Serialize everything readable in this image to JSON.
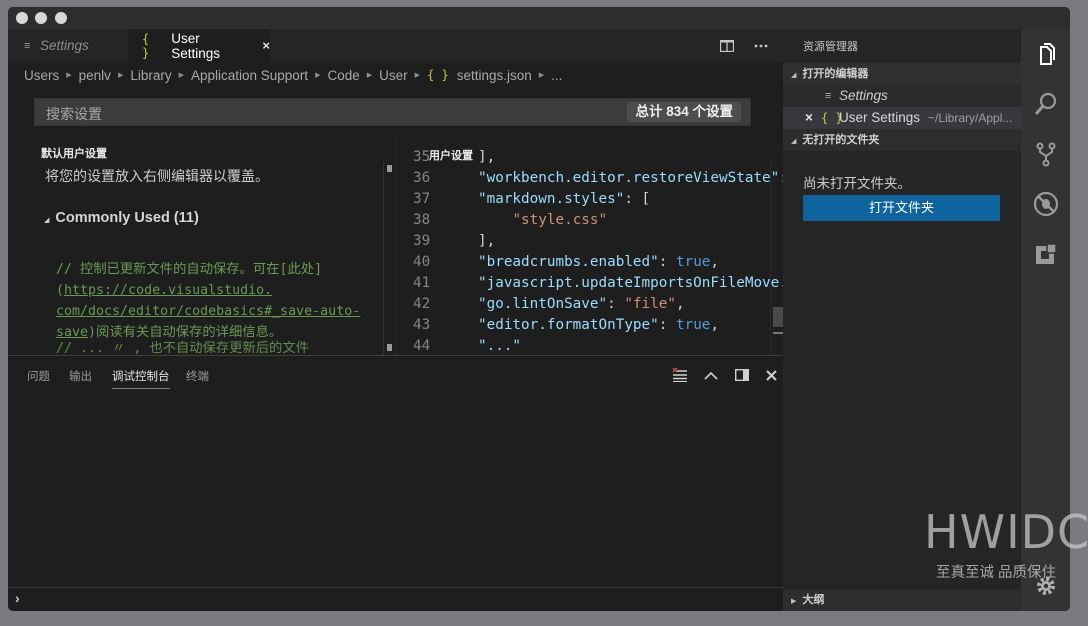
{
  "window": {
    "controls": [
      "close",
      "minimize",
      "maximize"
    ]
  },
  "tabs": [
    {
      "label": "Settings",
      "icon": "menu-icon",
      "active": false
    },
    {
      "label": "User Settings",
      "icon": "json-braces-icon",
      "icon_glyph": "{ }",
      "active": true,
      "close": "×"
    }
  ],
  "editor_actions": [
    "split-editor-icon",
    "more-actions-icon"
  ],
  "breadcrumb": [
    "Users",
    "penlv",
    "Library",
    "Application Support",
    "Code",
    "User",
    "settings.json",
    "..."
  ],
  "breadcrumb_file_icon": "{ }",
  "search": {
    "placeholder": "搜索设置",
    "count": "总计 834 个设置"
  },
  "default_settings": {
    "label": "默认用户设置",
    "hint": "将您的设置放入右侧编辑器以覆盖。",
    "section": "Commonly Used (11)",
    "comment_lines": [
      {
        "pre": "// 控制已更新文件的自动保存。可在[此处]",
        "link": ""
      },
      {
        "pre": "(",
        "link": "https://code.visualstudio."
      },
      {
        "pre": "",
        "link": "com/docs/editor/codebasics#_save-auto-"
      },
      {
        "pre": "",
        "link": "save",
        "post": ")阅读有关自动保存的详细信息。"
      },
      {
        "pre": "// ... 〃 , 也不自动保存更新后的文件",
        "link": ""
      }
    ]
  },
  "user_settings": {
    "label": "用户设置",
    "lines": [
      {
        "n": "35",
        "tokens": [
          {
            "t": "],",
            "c": ""
          }
        ]
      },
      {
        "n": "36",
        "tokens": [
          {
            "t": "\"workbench.editor.restoreViewState\"",
            "c": "k"
          },
          {
            "t": ":",
            "c": ""
          }
        ]
      },
      {
        "n": "37",
        "tokens": [
          {
            "t": "\"markdown.styles\"",
            "c": "k"
          },
          {
            "t": ": [",
            "c": ""
          }
        ]
      },
      {
        "n": "38",
        "tokens": [
          {
            "t": "    ",
            "c": ""
          },
          {
            "t": "\"style.css\"",
            "c": "s"
          }
        ]
      },
      {
        "n": "39",
        "tokens": [
          {
            "t": "],",
            "c": ""
          }
        ]
      },
      {
        "n": "40",
        "tokens": [
          {
            "t": "\"breadcrumbs.enabled\"",
            "c": "k"
          },
          {
            "t": ": ",
            "c": ""
          },
          {
            "t": "true",
            "c": "b"
          },
          {
            "t": ",",
            "c": ""
          }
        ]
      },
      {
        "n": "41",
        "tokens": [
          {
            "t": "\"javascript.updateImportsOnFileMove.e",
            "c": "k"
          }
        ]
      },
      {
        "n": "42",
        "tokens": [
          {
            "t": "\"go.lintOnSave\"",
            "c": "k"
          },
          {
            "t": ": ",
            "c": ""
          },
          {
            "t": "\"file\"",
            "c": "s"
          },
          {
            "t": ",",
            "c": ""
          }
        ]
      },
      {
        "n": "43",
        "tokens": [
          {
            "t": "\"editor.formatOnType\"",
            "c": "k"
          },
          {
            "t": ": ",
            "c": ""
          },
          {
            "t": "true",
            "c": "b"
          },
          {
            "t": ",",
            "c": ""
          }
        ]
      },
      {
        "n": "44",
        "tokens": [
          {
            "t": "\"...\"",
            "c": "k"
          }
        ]
      }
    ]
  },
  "panel": {
    "tabs": [
      {
        "label": "问题",
        "active": false
      },
      {
        "label": "输出",
        "active": false
      },
      {
        "label": "调试控制台",
        "active": true
      },
      {
        "label": "终端",
        "active": false
      }
    ],
    "actions": [
      "clear-console-icon",
      "maximize-panel-icon",
      "toggle-layout-icon",
      "close-panel-icon"
    ],
    "repl_prompt": "›"
  },
  "explorer": {
    "title": "资源管理器",
    "open_editors_header": "打开的编辑器",
    "open_editors": [
      {
        "label": "Settings",
        "icon": "≡",
        "italic": true,
        "path": ""
      },
      {
        "label": "User Settings",
        "icon": "{ }",
        "italic": false,
        "path": "~/Library/Appl...",
        "close": "×"
      }
    ],
    "no_folder_header": "无打开的文件夹",
    "no_folder_text": "尚未打开文件夹。",
    "open_folder_button": "打开文件夹",
    "outline_header": "大纲"
  },
  "activity_bar": [
    "explorer-icon",
    "search-icon",
    "source-control-icon",
    "debug-icon",
    "extensions-icon",
    "settings-gear-icon"
  ],
  "watermark": {
    "title": "HWIDC",
    "subtitle": "至真至诚 品质保住"
  },
  "colors": {
    "accent": "#0e639c",
    "json_key": "#9cdcfe",
    "json_string": "#ce9178",
    "json_bool": "#569cd6",
    "comment": "#6a9955",
    "braces": "#cbcb41"
  }
}
